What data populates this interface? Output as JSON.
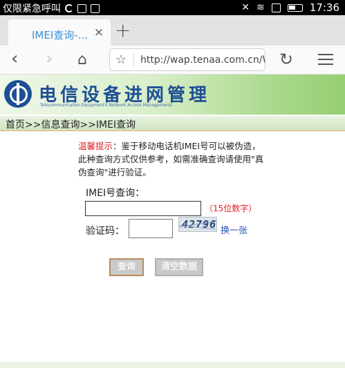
{
  "status_bar": {
    "carrier": "仅限紧急呼叫",
    "time": "17:36"
  },
  "browser": {
    "tab_title": "IMEI查询-...",
    "tab_close": "×",
    "new_tab": "+",
    "url": "http://wap.tenaa.com.cn/W"
  },
  "site": {
    "title": "电信设备进网管理",
    "subtitle": "Telecommunication Equipment's Network Access Managements",
    "breadcrumb": "首页>>信息查询>>IMEI查询"
  },
  "notice": {
    "label": "温馨提示",
    "text": "：鉴于移动电话机IMEI号可以被伪造，此种查询方式仅供参考，如需准确查询请使用\"真伪查询\"进行验证。"
  },
  "form": {
    "imei_label": "IMEI号查询：",
    "imei_value": "",
    "imei_hint": "（15位数字）",
    "captcha_label": "验证码：",
    "captcha_value": "",
    "captcha_image_text": "42796",
    "refresh_link": "换一张",
    "query_button": "查询",
    "clear_button": "清空数据"
  },
  "colors": {
    "accent_blue": "#1e4f95",
    "warning_red": "#e02020",
    "link_blue": "#2452b8"
  }
}
